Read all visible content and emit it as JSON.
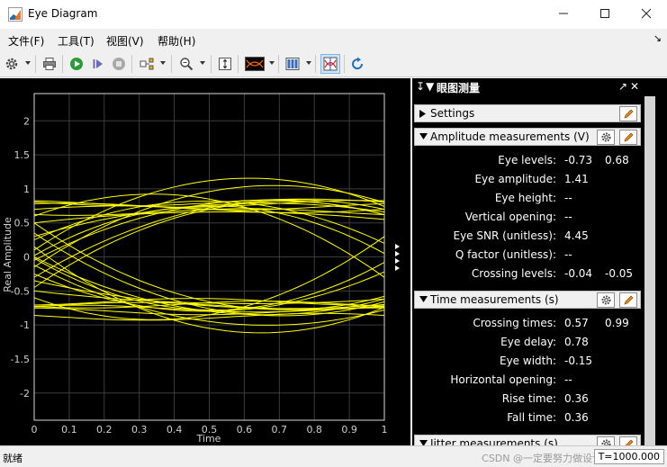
{
  "window": {
    "title": "Eye Diagram"
  },
  "menu": [
    {
      "label": "文件(F)"
    },
    {
      "label": "工具(T)"
    },
    {
      "label": "视图(V)"
    },
    {
      "label": "帮助(H)"
    }
  ],
  "toolbar": {
    "icons": [
      "gear-icon",
      "print-icon",
      "run-icon",
      "step-forward-icon",
      "stop-icon",
      "signal-select-icon",
      "zoom-icon",
      "scale-axes-icon",
      "eye-style-icon",
      "layout-icon",
      "measurements-icon",
      "refresh-icon"
    ]
  },
  "plot": {
    "y_ticks": [
      "2",
      "1.5",
      "1",
      "0.5",
      "0",
      "-0.5",
      "-1",
      "-1.5",
      "-2"
    ],
    "x_ticks": [
      "0",
      "0.1",
      "0.2",
      "0.3",
      "0.4",
      "0.5",
      "0.6",
      "0.7",
      "0.8",
      "0.9",
      "1"
    ],
    "xlabel": "Time",
    "ylabel": "Real Amplitude",
    "xlim": [
      0,
      1
    ],
    "ylim": [
      -2.4,
      2.4
    ],
    "grid": true,
    "trace_color": "#ffff00",
    "background": "#000000"
  },
  "panel": {
    "title": "眼图测量",
    "sections": {
      "settings": {
        "title": "Settings"
      },
      "amplitude": {
        "title": "Amplitude measurements (V)",
        "rows": [
          {
            "label": "Eye levels:",
            "v1": "-0.73",
            "v2": "0.68"
          },
          {
            "label": "Eye amplitude:",
            "v1": "1.41",
            "v2": ""
          },
          {
            "label": "Eye height:",
            "v1": "--",
            "v2": ""
          },
          {
            "label": "Vertical opening:",
            "v1": "--",
            "v2": ""
          },
          {
            "label": "Eye SNR (unitless):",
            "v1": "4.45",
            "v2": ""
          },
          {
            "label": "Q factor (unitless):",
            "v1": "--",
            "v2": ""
          },
          {
            "label": "Crossing levels:",
            "v1": "-0.04",
            "v2": "-0.05"
          }
        ]
      },
      "time": {
        "title": "Time measurements (s)",
        "rows": [
          {
            "label": "Crossing times:",
            "v1": "0.57",
            "v2": "0.99"
          },
          {
            "label": "Eye delay:",
            "v1": "0.78",
            "v2": ""
          },
          {
            "label": "Eye width:",
            "v1": "-0.15",
            "v2": ""
          },
          {
            "label": "Horizontal opening:",
            "v1": "--",
            "v2": ""
          },
          {
            "label": "Rise time:",
            "v1": "0.36",
            "v2": ""
          },
          {
            "label": "Fall time:",
            "v1": "0.36",
            "v2": ""
          }
        ]
      },
      "jitter": {
        "title": "Jitter measurements (s)"
      }
    }
  },
  "status": {
    "text": "就绪",
    "watermark": "CSDN @一定要努力做设计",
    "time": "T=1000.000"
  }
}
